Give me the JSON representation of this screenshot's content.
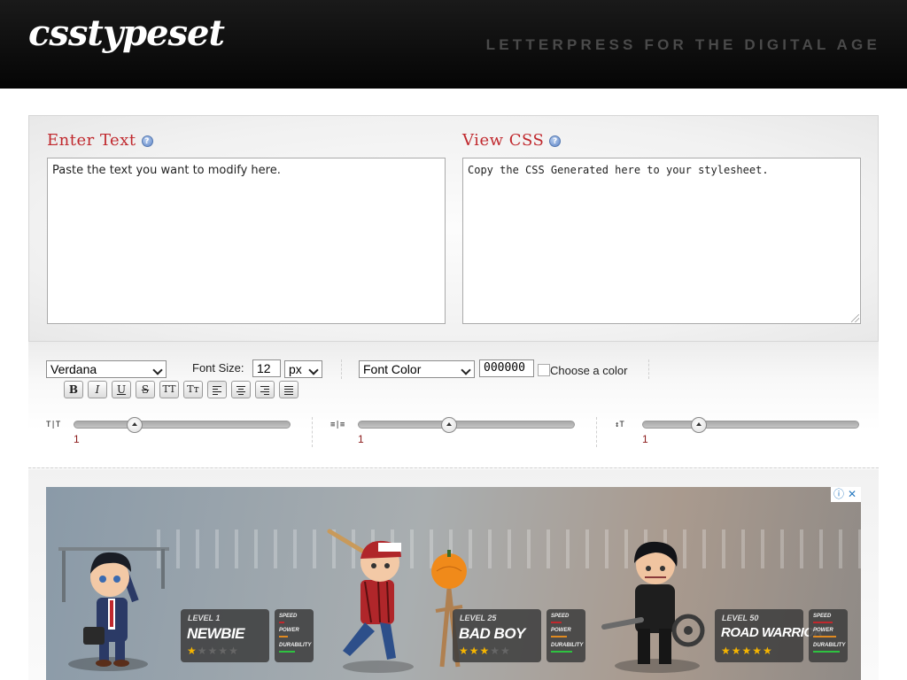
{
  "header": {
    "logo": "csstypeset",
    "tagline": "LETTERPRESS FOR THE DIGITAL AGE"
  },
  "editor": {
    "enter_text_title": "Enter Text",
    "enter_text_placeholder": "Paste the text you want to modify here.",
    "view_css_title": "View CSS",
    "view_css_placeholder": "Copy the CSS Generated here to your stylesheet.",
    "help_glyph": "?"
  },
  "toolbar": {
    "font_family": "Verdana",
    "font_size_label": "Font Size:",
    "font_size_value": "12",
    "font_size_unit": "px",
    "font_color_select": "Font Color",
    "font_color_value": "000000",
    "choose_color": "Choose a color",
    "format_buttons": {
      "bold": "B",
      "italic": "I",
      "underline": "U",
      "strikethrough": "S",
      "uppercase": "TT",
      "small_caps": "Tт"
    }
  },
  "sliders": [
    {
      "icon": "letter-spacing-icon",
      "glyph": "T|T",
      "value": "1",
      "level": 0.28
    },
    {
      "icon": "word-spacing-icon",
      "glyph": "≡|≡",
      "value": "1",
      "level": 0.42
    },
    {
      "icon": "line-height-icon",
      "glyph": "↕T",
      "value": "1",
      "level": 0.26
    }
  ],
  "ad": {
    "characters": [
      {
        "level": "LEVEL 1",
        "name": "NEWBIE",
        "stars": 1
      },
      {
        "level": "LEVEL 25",
        "name": "BAD BOY",
        "stars": 3
      },
      {
        "level": "LEVEL 50",
        "name": "ROAD WARRIOR",
        "stars": 5
      }
    ],
    "stat_labels": [
      "SPEED",
      "POWER",
      "DURABILITY"
    ],
    "info_glyph": "ⓘ",
    "close_glyph": "✕"
  },
  "colors": {
    "accent_red": "#c0282d",
    "header_bg": "#0a0a0a"
  }
}
